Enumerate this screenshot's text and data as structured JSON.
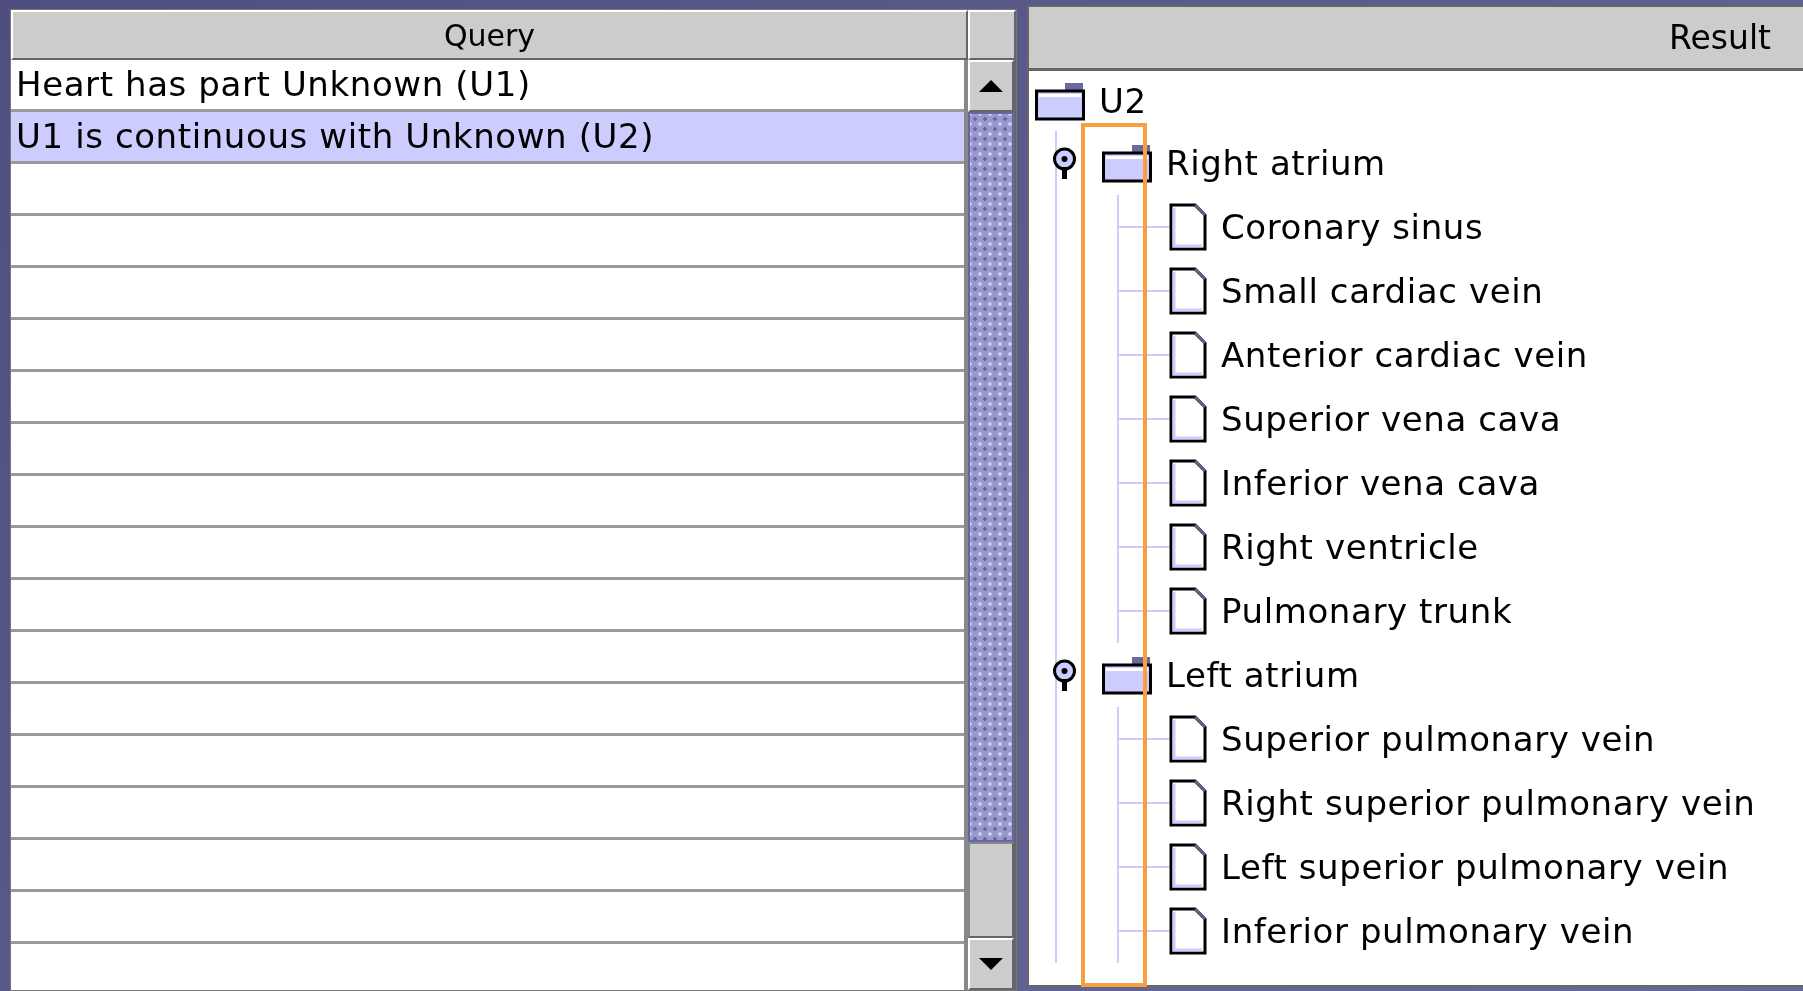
{
  "query_table": {
    "columns": [
      "Query"
    ],
    "rows": [
      {
        "text": "Heart has part Unknown (U1)",
        "selected": false
      },
      {
        "text": "U1 is continuous with Unknown (U2)",
        "selected": true
      }
    ]
  },
  "result_tree": {
    "header": "Result",
    "nodes": [
      {
        "label": "U2",
        "kind": "folder",
        "children": [
          {
            "label": "Right atrium",
            "kind": "folder",
            "expanded": true,
            "children": [
              {
                "label": "Coronary sinus",
                "kind": "leaf"
              },
              {
                "label": "Small cardiac vein",
                "kind": "leaf"
              },
              {
                "label": "Anterior cardiac vein",
                "kind": "leaf"
              },
              {
                "label": "Superior vena cava",
                "kind": "leaf"
              },
              {
                "label": "Inferior vena cava",
                "kind": "leaf"
              },
              {
                "label": "Right ventricle",
                "kind": "leaf"
              },
              {
                "label": "Pulmonary trunk",
                "kind": "leaf"
              }
            ]
          },
          {
            "label": "Left atrium",
            "kind": "folder",
            "expanded": true,
            "children": [
              {
                "label": "Superior pulmonary vein",
                "kind": "leaf"
              },
              {
                "label": "Right superior pulmonary vein",
                "kind": "leaf"
              },
              {
                "label": "Left superior pulmonary vein",
                "kind": "leaf"
              },
              {
                "label": "Inferior pulmonary vein",
                "kind": "leaf"
              }
            ]
          }
        ]
      }
    ]
  }
}
